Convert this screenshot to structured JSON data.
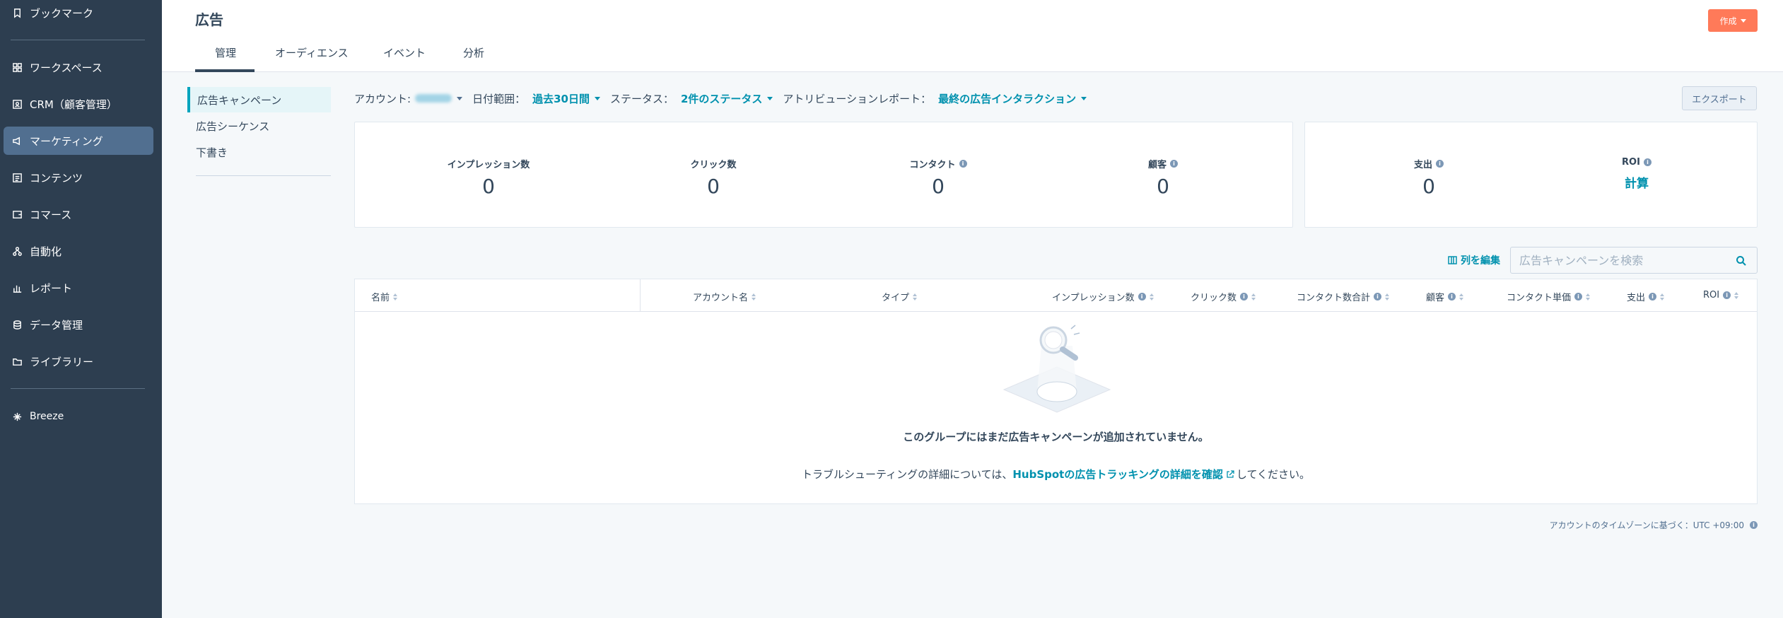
{
  "sidebar": {
    "items": [
      {
        "label": "ブックマーク",
        "icon": "bookmark-icon"
      },
      {
        "label": "ワークスペース",
        "icon": "grid-icon"
      },
      {
        "label": "CRM（顧客管理）",
        "icon": "contact-card-icon"
      },
      {
        "label": "マーケティング",
        "icon": "megaphone-icon",
        "active": true
      },
      {
        "label": "コンテンツ",
        "icon": "document-icon"
      },
      {
        "label": "コマース",
        "icon": "wallet-icon"
      },
      {
        "label": "自動化",
        "icon": "workflow-icon"
      },
      {
        "label": "レポート",
        "icon": "bar-chart-icon"
      },
      {
        "label": "データ管理",
        "icon": "database-icon"
      },
      {
        "label": "ライブラリー",
        "icon": "folder-icon"
      },
      {
        "label": "Breeze",
        "icon": "sparkle-icon"
      }
    ]
  },
  "header": {
    "title": "広告",
    "create_label": "作成",
    "tabs": [
      {
        "label": "管理",
        "active": true
      },
      {
        "label": "オーディエンス"
      },
      {
        "label": "イベント"
      },
      {
        "label": "分析"
      }
    ]
  },
  "subnav": {
    "items": [
      {
        "label": "広告キャンペーン",
        "active": true
      },
      {
        "label": "広告シーケンス"
      },
      {
        "label": "下書き"
      }
    ]
  },
  "filters": {
    "account_label": "アカウント:",
    "date_label": "日付範囲：",
    "date_value": "過去30日間",
    "status_label": "ステータス：",
    "status_value": "2件のステータス",
    "attribution_label": "アトリビューションレポート：",
    "attribution_value": "最終の広告インタラクション"
  },
  "export_label": "エクスポート",
  "kpis": {
    "impressions": {
      "label": "インプレッション数",
      "value": "0"
    },
    "clicks": {
      "label": "クリック数",
      "value": "0"
    },
    "contacts": {
      "label": "コンタクト",
      "value": "0"
    },
    "customers": {
      "label": "顧客",
      "value": "0"
    },
    "spend": {
      "label": "支出",
      "value": "0"
    },
    "roi": {
      "label": "ROI",
      "value": "計算"
    }
  },
  "table": {
    "edit_columns_label": "列を編集",
    "search_placeholder": "広告キャンペーンを検索",
    "columns": [
      "名前",
      "アカウント名",
      "タイプ",
      "インプレッション数",
      "クリック数",
      "コンタクト数合計",
      "顧客",
      "コンタクト単価",
      "支出",
      "ROI"
    ],
    "empty_title": "このグループにはまだ広告キャンペーンが追加されていません。",
    "empty_prefix": "トラブルシューティングの詳細については、",
    "empty_link": "HubSpotの広告トラッキングの詳細を確認",
    "empty_suffix": "してください。"
  },
  "timezone_note": "アカウントのタイムゾーンに基づく：UTC +09:00",
  "colors": {
    "sidebar": "#2d3e50",
    "accent": "#0091ae",
    "create_button": "#ff7a59",
    "active_nav": "#516f90"
  }
}
